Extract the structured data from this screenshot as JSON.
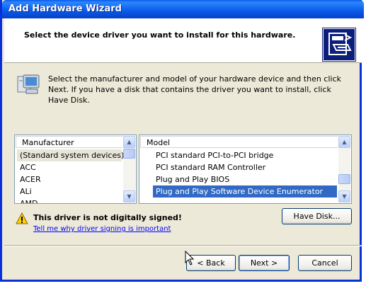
{
  "window": {
    "title": "Add Hardware Wizard"
  },
  "header": {
    "title": "Select the device driver you want to install for this hardware."
  },
  "intro": {
    "text": "Select the manufacturer and model of your hardware device and then click Next. If you have a disk that contains the driver you want to install, click Have Disk."
  },
  "manufacturer_list": {
    "header": "Manufacturer",
    "items": [
      "(Standard system devices)",
      "ACC",
      "ACER",
      "ALi",
      "AMD"
    ],
    "selected_index": 0
  },
  "model_list": {
    "header": "Model",
    "items": [
      "PCI standard PCI-to-PCI bridge",
      "PCI standard RAM Controller",
      "Plug and Play BIOS",
      "Plug and Play Software Device Enumerator"
    ],
    "selected_index": 3
  },
  "warning": {
    "title": "This driver is not digitally signed!",
    "link": "Tell me why driver signing is important"
  },
  "buttons": {
    "have_disk": "Have Disk...",
    "back": "< Back",
    "next": "Next >",
    "cancel": "Cancel"
  },
  "icons": {
    "header": "hardware-icon",
    "intro": "computer-icon",
    "warning": "warning-icon",
    "cursor": "mouse-pointer-icon"
  },
  "colors": {
    "titlebar": "#0a5ae8",
    "selection": "#316ac5",
    "link": "#0000ff"
  }
}
